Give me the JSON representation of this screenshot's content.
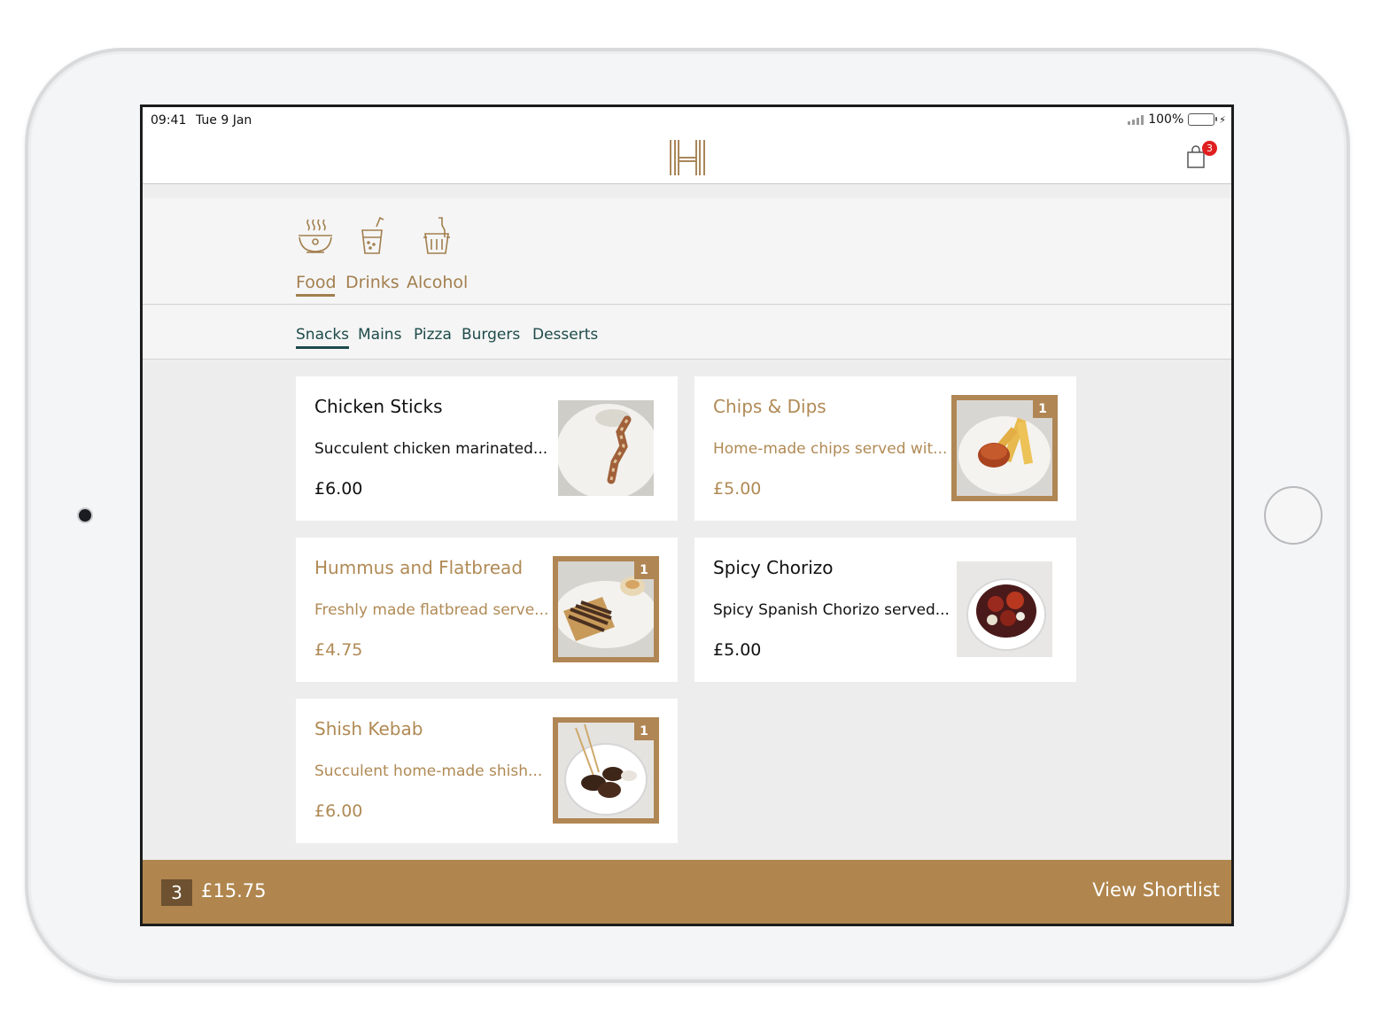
{
  "status": {
    "time": "09:41",
    "date": "Tue 9 Jan",
    "battery": "100%"
  },
  "header": {
    "logo_icon": "hotel-h-logo",
    "cart_icon": "shopping-bag-icon",
    "cart_count": "3"
  },
  "categories": [
    {
      "label": "Food",
      "icon": "soup-bowl-icon",
      "active": true
    },
    {
      "label": "Drinks",
      "icon": "drink-cup-icon",
      "active": false
    },
    {
      "label": "Alcohol",
      "icon": "ice-bucket-icon",
      "active": false
    }
  ],
  "subcategories": [
    {
      "label": "Snacks",
      "active": true
    },
    {
      "label": "Mains",
      "active": false
    },
    {
      "label": "Pizza",
      "active": false
    },
    {
      "label": "Burgers",
      "active": false
    },
    {
      "label": "Desserts",
      "active": false
    }
  ],
  "items": [
    {
      "title": "Chicken Sticks",
      "desc": "Succulent chicken marinated...",
      "price": "£6.00",
      "selected": false,
      "qty": ""
    },
    {
      "title": "Chips & Dips",
      "desc": "Home-made chips served wit...",
      "price": "£5.00",
      "selected": true,
      "qty": "1"
    },
    {
      "title": "Hummus and Flatbread",
      "desc": "Freshly made flatbread serve...",
      "price": "£4.75",
      "selected": true,
      "qty": "1"
    },
    {
      "title": "Spicy Chorizo",
      "desc": "Spicy Spanish Chorizo served...",
      "price": "£5.00",
      "selected": false,
      "qty": ""
    },
    {
      "title": "Shish Kebab",
      "desc": "Succulent home-made shish...",
      "price": "£6.00",
      "selected": true,
      "qty": "1"
    }
  ],
  "footer": {
    "count": "3",
    "total": "£15.75",
    "action": "View Shortlist"
  },
  "colors": {
    "accent": "#b0864e",
    "teal": "#1e4a4a"
  }
}
